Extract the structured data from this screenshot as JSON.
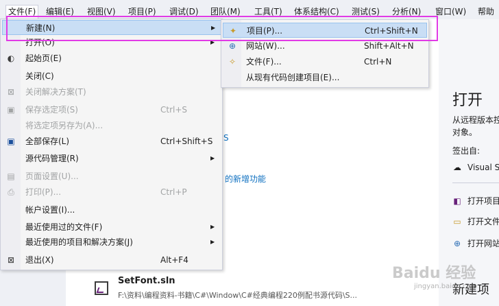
{
  "menubar": {
    "items": [
      {
        "label": "文件(F)"
      },
      {
        "label": "编辑(E)"
      },
      {
        "label": "视图(V)"
      },
      {
        "label": "项目(P)"
      },
      {
        "label": "调试(D)"
      },
      {
        "label": "团队(M)"
      },
      {
        "label": "工具(T)"
      },
      {
        "label": "体系结构(C)"
      },
      {
        "label": "测试(S)"
      },
      {
        "label": "分析(N)"
      },
      {
        "label": "窗口(W)"
      },
      {
        "label": "帮助"
      }
    ]
  },
  "file_menu": {
    "items": [
      {
        "label": "新建(N)",
        "shortcut": "",
        "icon": "none",
        "submenu": true,
        "disabled": false,
        "highlighted": true
      },
      {
        "label": "打开(O)",
        "shortcut": "",
        "icon": "none",
        "submenu": true,
        "disabled": false
      },
      {
        "label": "起始页(E)",
        "shortcut": "",
        "icon": "start-page-icon",
        "submenu": false,
        "disabled": false
      },
      {
        "label": "关闭(C)",
        "shortcut": "",
        "icon": "none",
        "submenu": false,
        "disabled": false
      },
      {
        "label": "关闭解决方案(T)",
        "shortcut": "",
        "icon": "close-solution-icon",
        "submenu": false,
        "disabled": true
      },
      {
        "label": "保存选定项(S)",
        "shortcut": "Ctrl+S",
        "icon": "save-icon",
        "submenu": false,
        "disabled": true
      },
      {
        "label": "将选定项另存为(A)...",
        "shortcut": "",
        "icon": "none",
        "submenu": false,
        "disabled": true
      },
      {
        "label": "全部保存(L)",
        "shortcut": "Ctrl+Shift+S",
        "icon": "save-all-icon",
        "submenu": false,
        "disabled": false
      },
      {
        "label": "源代码管理(R)",
        "shortcut": "",
        "icon": "none",
        "submenu": true,
        "disabled": false
      },
      {
        "label": "页面设置(U)...",
        "shortcut": "",
        "icon": "page-setup-icon",
        "submenu": false,
        "disabled": true
      },
      {
        "label": "打印(P)...",
        "shortcut": "Ctrl+P",
        "icon": "print-icon",
        "submenu": false,
        "disabled": true
      },
      {
        "label": "帐户设置(I)...",
        "shortcut": "",
        "icon": "none",
        "submenu": false,
        "disabled": false
      },
      {
        "label": "最近使用过的文件(F)",
        "shortcut": "",
        "icon": "none",
        "submenu": true,
        "disabled": false
      },
      {
        "label": "最近使用的项目和解决方案(J)",
        "shortcut": "",
        "icon": "none",
        "submenu": true,
        "disabled": false
      },
      {
        "label": "退出(X)",
        "shortcut": "Alt+F4",
        "icon": "exit-icon",
        "submenu": false,
        "disabled": false
      }
    ]
  },
  "new_submenu": {
    "items": [
      {
        "label": "项目(P)...",
        "shortcut": "Ctrl+Shift+N",
        "icon": "new-project-icon",
        "highlighted": true
      },
      {
        "label": "网站(W)...",
        "shortcut": "Shift+Alt+N",
        "icon": "website-icon"
      },
      {
        "label": "文件(F)...",
        "shortcut": "Ctrl+N",
        "icon": "new-file-icon"
      },
      {
        "label": "从现有代码创建项目(E)...",
        "shortcut": "",
        "icon": "none"
      }
    ]
  },
  "start_page": {
    "link_fragment_1": "S",
    "link_fragment_2": "的新增功能",
    "open_title": "打开",
    "open_desc_line1": "从远程版本控",
    "open_desc_line2": "对象。",
    "signin_label": "签出自:",
    "vsts_label": "Visual S",
    "open_project": "打开项目",
    "open_file": "打开文件",
    "open_website": "打开网站",
    "new_project_heading": "新建项"
  },
  "recent": {
    "name": "SetFont.sln",
    "path": "F:\\资料\\编程资料-书籍\\C#\\Window\\C#经典编程220例配书源代码\\S..."
  },
  "watermark": {
    "text": "Baidu 经验",
    "sub": "jingyan.baidu.com"
  }
}
